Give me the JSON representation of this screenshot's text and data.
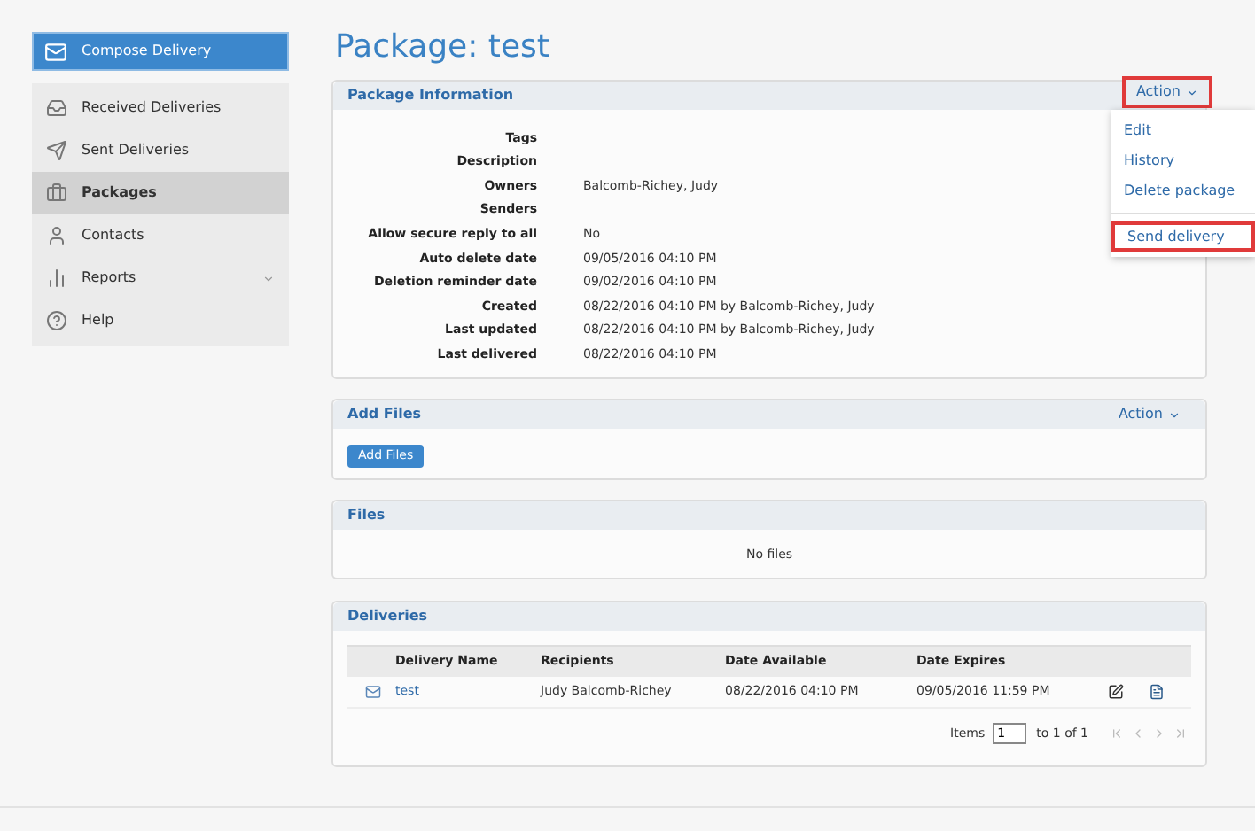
{
  "sidebar": {
    "compose_button": "Compose Delivery",
    "items": [
      {
        "label": "Received Deliveries",
        "kind": "inbox",
        "selected": false
      },
      {
        "label": "Sent Deliveries",
        "kind": "send",
        "selected": false
      },
      {
        "label": "Packages",
        "kind": "briefcase",
        "selected": true
      },
      {
        "label": "Contacts",
        "kind": "user",
        "selected": false
      },
      {
        "label": "Reports",
        "kind": "chart",
        "selected": false,
        "has_submenu": true
      },
      {
        "label": "Help",
        "kind": "help",
        "selected": false
      }
    ]
  },
  "page_title": "Package: test",
  "package_information": {
    "title": "Package Information",
    "action_button": {
      "label": "Action",
      "highlighted": true
    },
    "action_menu": [
      {
        "label": "Edit",
        "highlighted": false
      },
      {
        "label": "History",
        "highlighted": false
      },
      {
        "label": "Delete package",
        "highlighted": false
      },
      {
        "label": "Send delivery",
        "highlighted": true
      }
    ],
    "fields": [
      {
        "label": "Tags"
      },
      {
        "label": "Description"
      },
      {
        "label": "Owners",
        "value": "Balcomb-Richey, Judy"
      },
      {
        "label": "Senders"
      },
      {
        "label": "Allow secure reply to all",
        "value": "No"
      },
      {
        "label": "Auto delete date",
        "value": "09/05/2016 04:10 PM"
      },
      {
        "label": "Deletion reminder date",
        "value": "09/02/2016 04:10 PM"
      },
      {
        "label": "Created",
        "value": "08/22/2016 04:10 PM by Balcomb-Richey, Judy"
      },
      {
        "label": "Last updated",
        "value": "08/22/2016 04:10 PM by Balcomb-Richey, Judy"
      },
      {
        "label": "Last delivered",
        "value": "08/22/2016 04:10 PM"
      }
    ]
  },
  "add_files": {
    "title": "Add Files",
    "action_button": "Action",
    "button": "Add Files"
  },
  "files": {
    "title": "Files",
    "empty_text": "No files"
  },
  "deliveries": {
    "title": "Deliveries",
    "columns": [
      "Delivery Name",
      "Recipients",
      "Date Available",
      "Date Expires"
    ],
    "rows": [
      {
        "name": "test",
        "recipients": "Judy Balcomb-Richey",
        "date_available": "08/22/2016 04:10 PM",
        "date_expires": "09/05/2016 11:59 PM"
      }
    ],
    "pager": {
      "items_label": "Items",
      "page": "1",
      "range_text": "to 1 of 1"
    }
  }
}
